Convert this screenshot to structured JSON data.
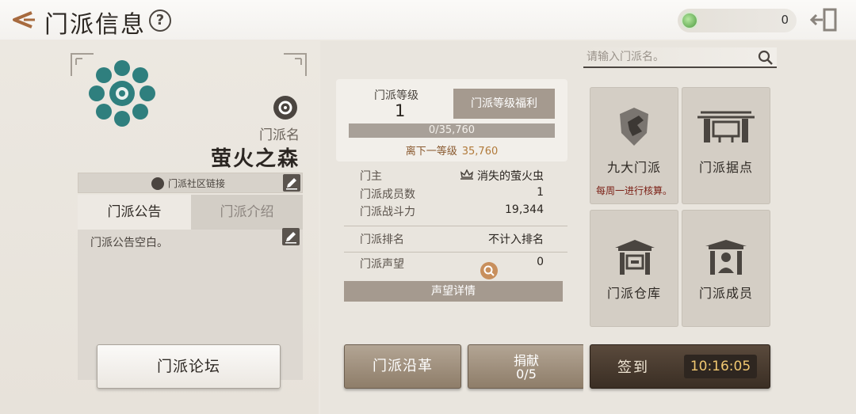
{
  "header": {
    "title": "门派信息",
    "help": "?",
    "currency_amount": "0"
  },
  "guild": {
    "name_label": "门派名",
    "name": "萤火之森",
    "community_link_label": "门派社区链接",
    "tabs": [
      {
        "label": "门派公告",
        "active": true
      },
      {
        "label": "门派介绍",
        "active": false
      }
    ],
    "notice_text": "门派公告空白。",
    "forum_button": "门派论坛"
  },
  "level": {
    "label": "门派等级",
    "value": "1",
    "benefit_button": "门派等级福利",
    "progress_text": "0/35,760",
    "progress_fraction": 0.0,
    "next_label": "离下一等级",
    "next_value": "35,760"
  },
  "stats": {
    "leader_label": "门主",
    "leader_value": "消失的萤火虫",
    "members_label": "门派成员数",
    "members_value": "1",
    "power_label": "门派战斗力",
    "power_value": "19,344",
    "rank_label": "门派排名",
    "rank_value": "不计入排名",
    "prestige_label": "门派声望",
    "prestige_value": "0",
    "prestige_details_button": "声望详情"
  },
  "buttons": {
    "history": "门派沿革",
    "donate_title": "捐献",
    "donate_count": "0/5",
    "checkin": "签到",
    "checkin_timer": "10:16:05"
  },
  "search": {
    "placeholder": "请输入门派名。"
  },
  "tiles": {
    "nine_sects": "九大门派",
    "nine_sects_note": "每周一进行核算。",
    "stronghold": "门派据点",
    "warehouse": "门派仓库",
    "members": "门派成员"
  },
  "colors": {
    "accent_brown": "#a59a8f",
    "dark_button": "#3a2e24",
    "timer_text": "#f0c770",
    "emblem": "#2f7f7e"
  }
}
